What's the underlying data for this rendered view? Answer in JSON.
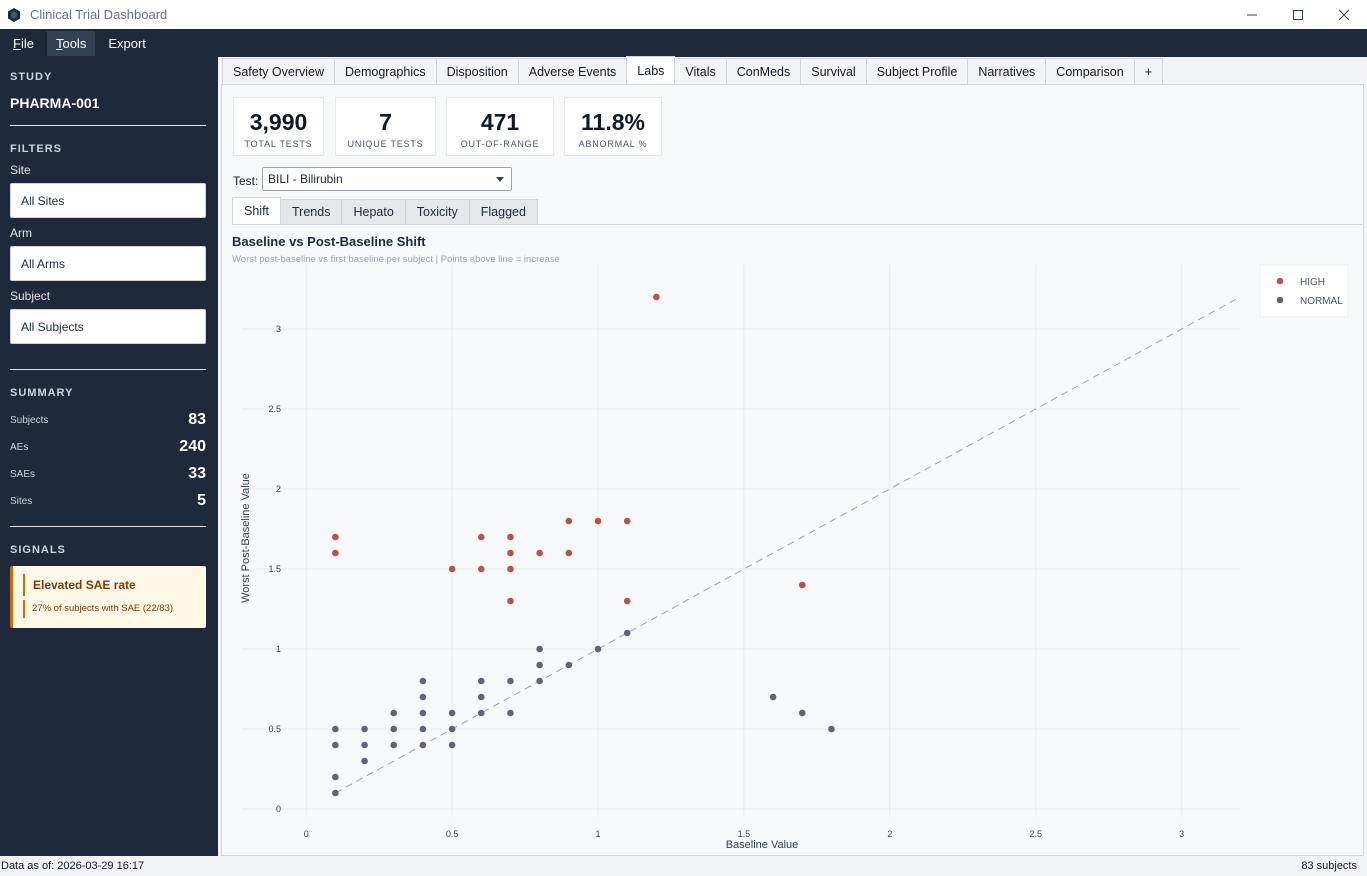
{
  "window": {
    "title": "Clinical Trial Dashboard"
  },
  "menu": [
    {
      "label": "File",
      "accel": "F",
      "rest": "ile"
    },
    {
      "label": "Tools",
      "accel": "T",
      "rest": "ools"
    },
    {
      "label": "Export",
      "accel": "",
      "rest": "Export"
    }
  ],
  "sidebar": {
    "study_heading": "STUDY",
    "study_code": "PHARMA-001",
    "filters_heading": "FILTERS",
    "site_label": "Site",
    "site_value": "All Sites",
    "arm_label": "Arm",
    "arm_value": "All Arms",
    "subject_label": "Subject",
    "subject_value": "All Subjects",
    "summary_heading": "SUMMARY",
    "summary": [
      {
        "key": "Subjects",
        "value": "83"
      },
      {
        "key": "AEs",
        "value": "240"
      },
      {
        "key": "SAEs",
        "value": "33"
      },
      {
        "key": "Sites",
        "value": "5"
      }
    ],
    "signals_heading": "SIGNALS",
    "signal_title": "Elevated SAE rate",
    "signal_desc": "27% of subjects with SAE (22/83)"
  },
  "tabs": [
    "Safety Overview",
    "Demographics",
    "Disposition",
    "Adverse Events",
    "Labs",
    "Vitals",
    "ConMeds",
    "Survival",
    "Subject Profile",
    "Narratives",
    "Comparison",
    "+"
  ],
  "active_tab": "Labs",
  "kpis": [
    {
      "value": "3,990",
      "label": "TOTAL TESTS"
    },
    {
      "value": "7",
      "label": "UNIQUE TESTS"
    },
    {
      "value": "471",
      "label": "OUT-OF-RANGE"
    },
    {
      "value": "11.8%",
      "label": "ABNORMAL %"
    }
  ],
  "test_select": {
    "label": "Test:",
    "value": "BILI - Bilirubin"
  },
  "subtabs": [
    "Shift",
    "Trends",
    "Hepato",
    "Toxicity",
    "Flagged"
  ],
  "active_subtab": "Shift",
  "chart_data": {
    "type": "scatter",
    "title": "Baseline vs Post-Baseline Shift",
    "subtitle": "Worst post-baseline vs first baseline per subject | Points above line = increase",
    "xlabel": "Baseline Value",
    "ylabel": "Worst Post-Baseline Value",
    "xlim": [
      -0.22,
      3.2
    ],
    "ylim": [
      -0.05,
      3.4
    ],
    "x_ticks": [
      0,
      0.5,
      1,
      1.5,
      2,
      2.5,
      3
    ],
    "x_tick_labels": [
      "0",
      "0.5",
      "1",
      "1.5",
      "2",
      "2.5",
      "3"
    ],
    "y_ticks": [
      0,
      0.5,
      1,
      1.5,
      2,
      2.5,
      3
    ],
    "y_tick_labels": [
      "0",
      "0.5",
      "1",
      "1.5",
      "2",
      "2.5",
      "3"
    ],
    "grid": true,
    "legend_position": "top-right",
    "reference_line": "y = x (dashed)",
    "series": [
      {
        "name": "HIGH",
        "color": "#b5544a",
        "points": [
          [
            0.1,
            1.7
          ],
          [
            0.1,
            1.6
          ],
          [
            0.5,
            1.5
          ],
          [
            0.6,
            1.7
          ],
          [
            0.6,
            1.5
          ],
          [
            0.7,
            1.7
          ],
          [
            0.7,
            1.6
          ],
          [
            0.7,
            1.5
          ],
          [
            0.7,
            1.3
          ],
          [
            0.8,
            1.6
          ],
          [
            0.9,
            1.8
          ],
          [
            0.9,
            1.6
          ],
          [
            1.0,
            1.8
          ],
          [
            1.1,
            1.8
          ],
          [
            1.1,
            1.3
          ],
          [
            1.2,
            3.2
          ],
          [
            1.7,
            1.4
          ]
        ]
      },
      {
        "name": "NORMAL",
        "color": "#5f6472",
        "points": [
          [
            0.1,
            0.5
          ],
          [
            0.1,
            0.4
          ],
          [
            0.1,
            0.2
          ],
          [
            0.1,
            0.1
          ],
          [
            0.2,
            0.5
          ],
          [
            0.2,
            0.4
          ],
          [
            0.2,
            0.3
          ],
          [
            0.3,
            0.6
          ],
          [
            0.3,
            0.5
          ],
          [
            0.3,
            0.4
          ],
          [
            0.4,
            0.8
          ],
          [
            0.4,
            0.7
          ],
          [
            0.4,
            0.6
          ],
          [
            0.4,
            0.5
          ],
          [
            0.4,
            0.4
          ],
          [
            0.5,
            0.6
          ],
          [
            0.5,
            0.5
          ],
          [
            0.5,
            0.4
          ],
          [
            0.6,
            0.8
          ],
          [
            0.6,
            0.7
          ],
          [
            0.6,
            0.6
          ],
          [
            0.7,
            0.8
          ],
          [
            0.7,
            0.6
          ],
          [
            0.8,
            1.0
          ],
          [
            0.8,
            0.9
          ],
          [
            0.8,
            0.8
          ],
          [
            0.9,
            0.9
          ],
          [
            1.0,
            1.0
          ],
          [
            1.1,
            1.1
          ],
          [
            1.6,
            0.7
          ],
          [
            1.7,
            0.6
          ],
          [
            1.8,
            0.5
          ]
        ]
      }
    ]
  },
  "statusbar": {
    "left": "Data as of: 2026-03-29 16:17",
    "right": "83 subjects"
  }
}
